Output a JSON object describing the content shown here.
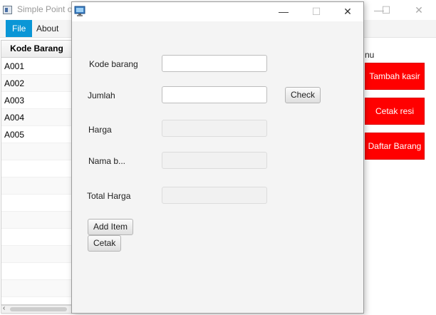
{
  "main_window": {
    "title": "Simple Point o",
    "controls": {
      "minimize": "—",
      "maximize": "☐",
      "close": "✕"
    }
  },
  "menubar": {
    "items": [
      "File",
      "About"
    ]
  },
  "table": {
    "header": "Kode Barang",
    "rows": [
      "A001",
      "A002",
      "A003",
      "A004",
      "A005",
      "",
      "",
      "",
      "",
      "",
      "",
      "",
      "",
      "",
      ""
    ]
  },
  "side_menu": {
    "label": "nu",
    "buttons": [
      "Tambah kasir",
      "Cetak resi",
      "Daftar Barang"
    ],
    "button_color": "#ff0000"
  },
  "dialog": {
    "icon": "monitor-icon",
    "controls": {
      "minimize": "—",
      "maximize": "☐",
      "close": "✕"
    },
    "fields": {
      "kode_barang": {
        "label": "Kode barang",
        "value": ""
      },
      "jumlah": {
        "label": "Jumlah",
        "value": ""
      },
      "harga": {
        "label": "Harga",
        "value": ""
      },
      "nama_barang": {
        "label": "Nama b...",
        "value": ""
      },
      "total_harga": {
        "label": "Total Harga",
        "value": ""
      }
    },
    "check_button": "Check",
    "add_item_button": "Add Item",
    "cetak_button": "Cetak"
  },
  "colors": {
    "menu_active": "#0a96d6",
    "side_button": "#ff0000"
  }
}
